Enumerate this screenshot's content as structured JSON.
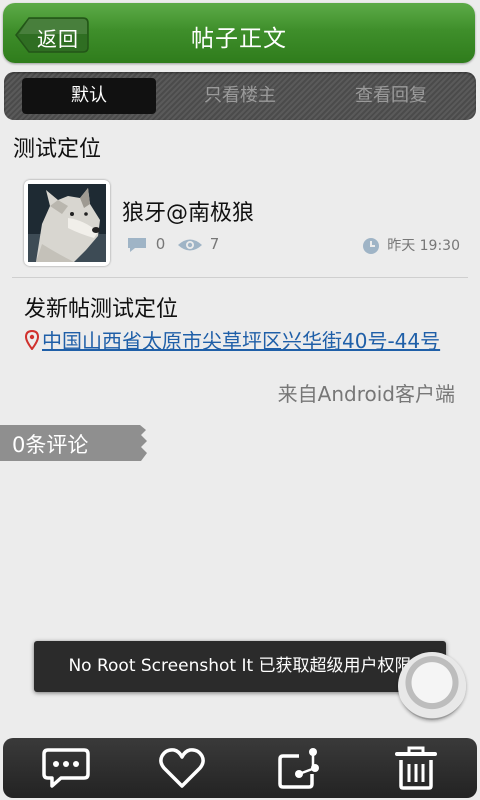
{
  "header": {
    "back_label": "返回",
    "title": "帖子正文"
  },
  "tabs": [
    {
      "label": "默认",
      "active": true
    },
    {
      "label": "只看楼主",
      "active": false
    },
    {
      "label": "查看回复",
      "active": false
    }
  ],
  "post": {
    "board_title": "测试定位",
    "author": "狼牙@南极狼",
    "comment_count": "0",
    "view_count": "7",
    "time": "昨天 19:30",
    "body": "发新帖测试定位",
    "location": "中国山西省太原市尖草坪区兴华街40号-44号",
    "source": "来自Android客户端"
  },
  "comments": {
    "count_label": "0条评论"
  },
  "toast": {
    "text": "No Root Screenshot It 已获取超级用户权限"
  },
  "bottom_bar": {
    "icons": [
      "comment-icon",
      "heart-icon",
      "share-icon",
      "trash-icon"
    ]
  },
  "colors": {
    "header_green": "#3f8f2b",
    "link_blue": "#1f5fa8",
    "pin_red": "#d0312d"
  }
}
